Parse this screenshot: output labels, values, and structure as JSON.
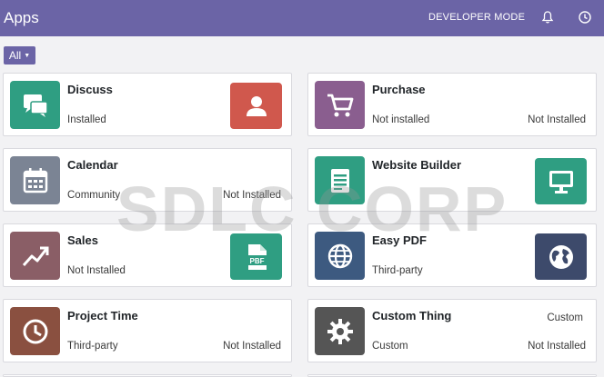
{
  "header": {
    "title": "Apps",
    "developer_mode": "DEVELOPER MODE",
    "bell_icon": "bell-icon",
    "clock_icon": "clock-icon",
    "background": "#6b64a6"
  },
  "filter": {
    "label": "All"
  },
  "apps": [
    {
      "name": "Discuss",
      "status": "Installed",
      "icon": "chat-icon",
      "color": "#2f9e82",
      "right_icon": "user-icon",
      "right_color": "#d0584d"
    },
    {
      "name": "Purchase",
      "status": "Not installed",
      "status_right": "Not Installed",
      "icon": "cart-icon",
      "color": "#8a5e8f"
    },
    {
      "name": "Calendar",
      "status": "Community",
      "status_right": "Not Installed",
      "icon": "calendar-icon",
      "color": "#7b8494"
    },
    {
      "name": "Website Builder",
      "icon": "document-icon",
      "color": "#2f9e82",
      "right_icon": "monitor-icon",
      "right_color": "#2f9e82"
    },
    {
      "name": "Sales",
      "status": "Not Installed",
      "icon": "trend-icon",
      "color": "#8a5e66",
      "right_icon": "pdf-file-icon",
      "right_color": "#2f9e82",
      "right_label": "PBF"
    },
    {
      "name": "Easy PDF",
      "status": "Third-party",
      "icon": "globe-icon",
      "color": "#3d5a80",
      "right_icon": "earth-icon",
      "right_color": "#3d4a6b"
    },
    {
      "name": "Project Time",
      "status": "Third-party",
      "status_right": "Not Installed",
      "icon": "clock-icon",
      "color": "#8a5040"
    },
    {
      "name": "Custom Thing",
      "status": "Custom",
      "status_right": "Not Installed",
      "tag_top": "Custom",
      "icon": "gear-icon",
      "color": "#555555"
    }
  ],
  "watermark": "SDLC CORP"
}
